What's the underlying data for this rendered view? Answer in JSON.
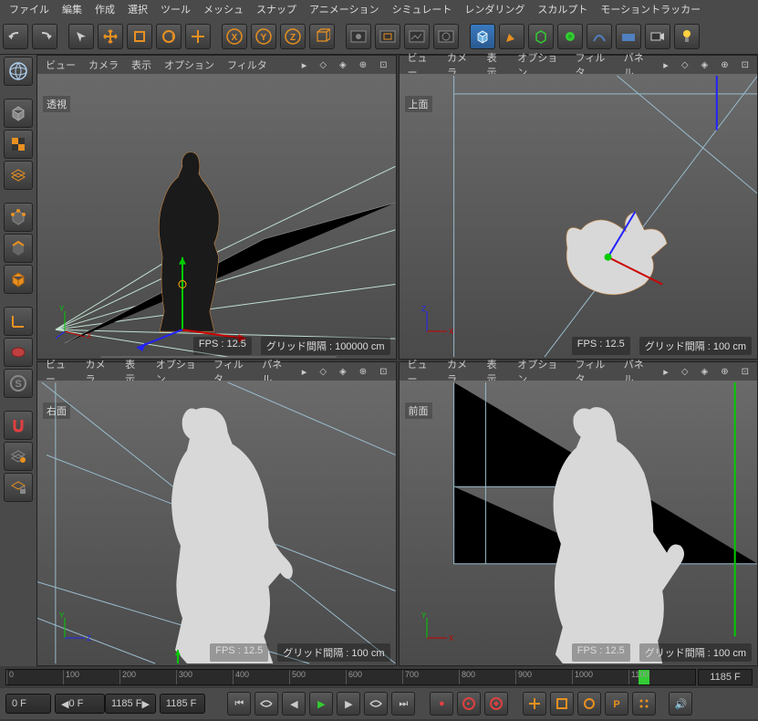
{
  "menus": [
    "ファイル",
    "編集",
    "作成",
    "選択",
    "ツール",
    "メッシュ",
    "スナップ",
    "アニメーション",
    "シミュレート",
    "レンダリング",
    "スカルプト",
    "モーショントラッカー"
  ],
  "view_menus": [
    "ビュー",
    "カメラ",
    "表示",
    "オプション",
    "フィルタ"
  ],
  "view_menus_ext": [
    "ビュー",
    "カメラ",
    "表示",
    "オプション",
    "フィルタ",
    "パネル"
  ],
  "views": {
    "persp": {
      "label": "透視",
      "fps": "FPS : 12.5",
      "grid": "グリッド間隔 : 100000 cm"
    },
    "top": {
      "label": "上面",
      "fps": "FPS : 12.5",
      "grid": "グリッド間隔 : 100 cm"
    },
    "right": {
      "label": "右面",
      "fps": "FPS : 12.5",
      "grid": "グリッド間隔 : 100 cm"
    },
    "front": {
      "label": "前面",
      "fps": "FPS : 12.5",
      "grid": "グリッド間隔 : 100 cm"
    }
  },
  "timeline": {
    "ticks": [
      "0",
      "100",
      "200",
      "300",
      "400",
      "500",
      "600",
      "700",
      "800",
      "900",
      "1000",
      "1100"
    ],
    "current": "1185 F",
    "range_start": "0 F",
    "range_a": "0 F",
    "range_b": "1185 F",
    "range_end": "1185 F"
  }
}
